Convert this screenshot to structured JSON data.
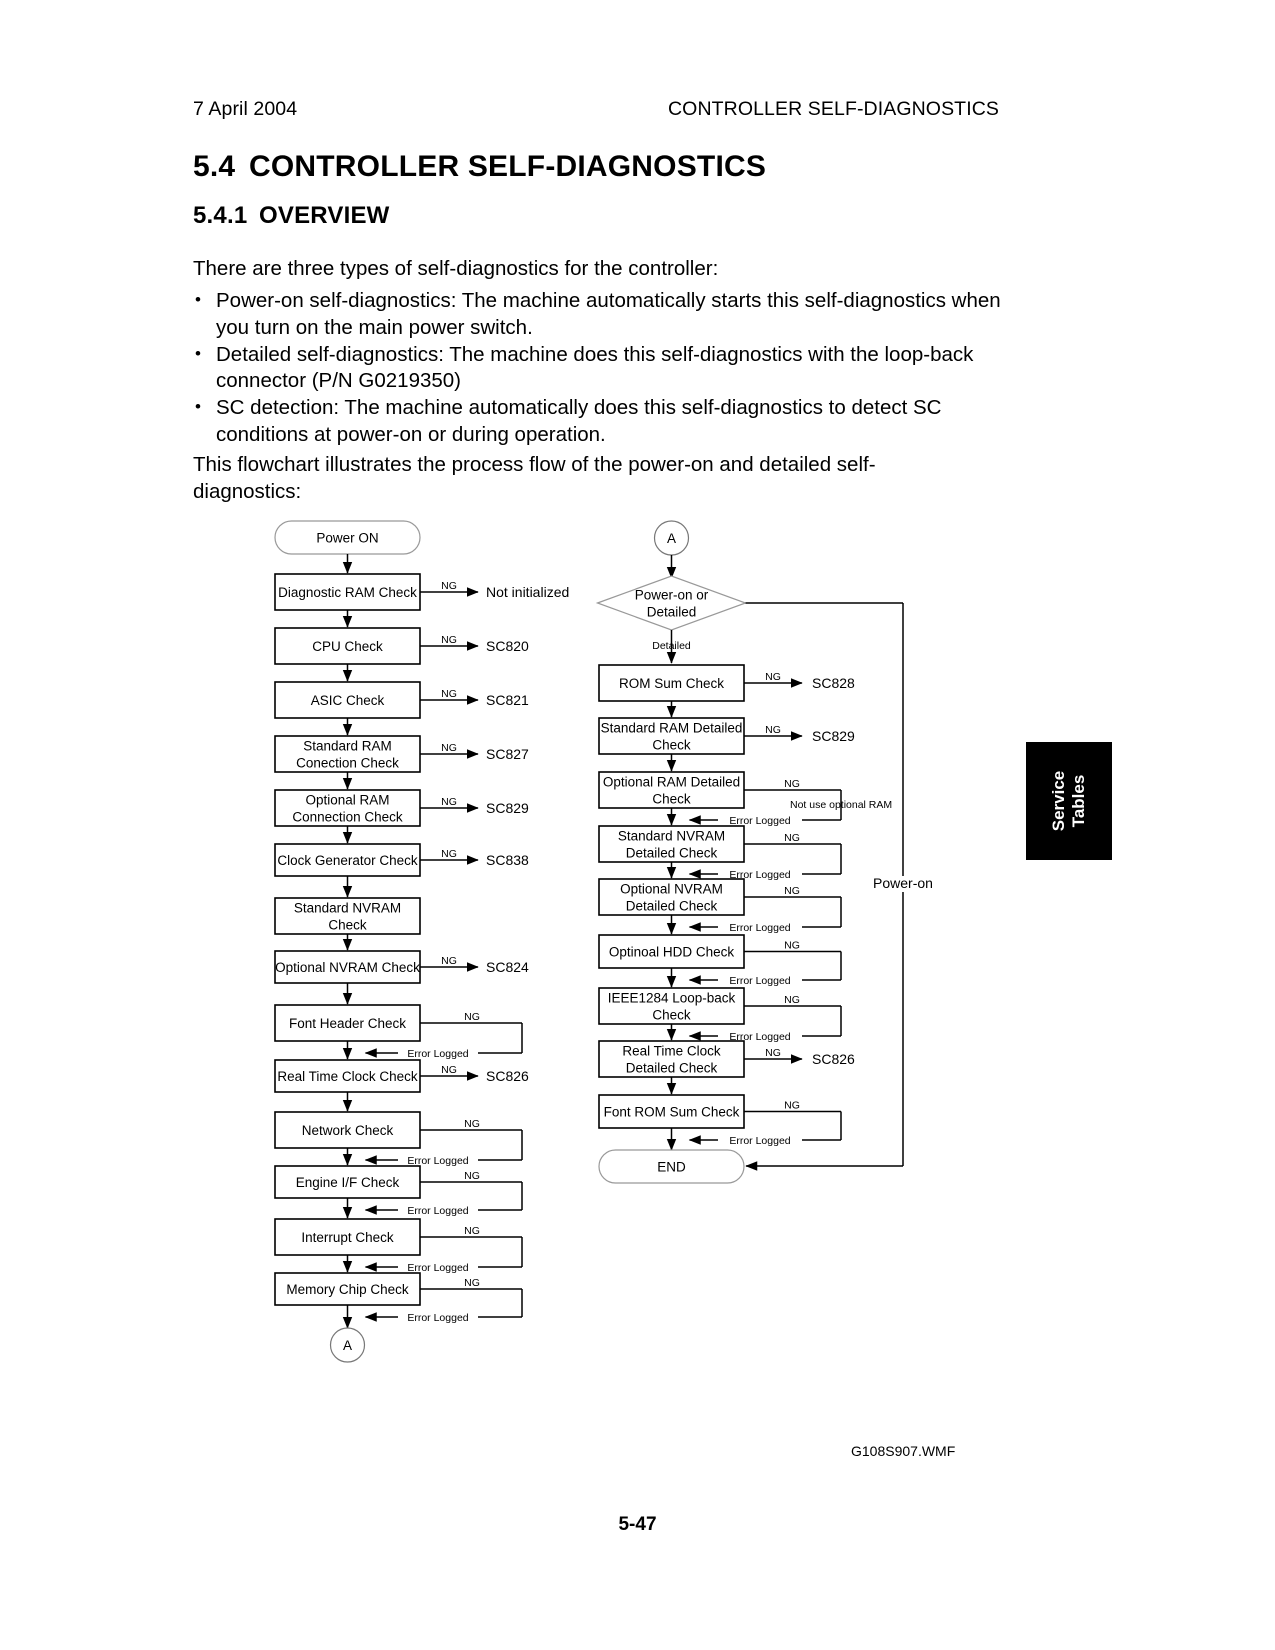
{
  "header": {
    "date": "7 April 2004",
    "title": "CONTROLLER SELF-DIAGNOSTICS"
  },
  "headings": {
    "section_number": "5.4",
    "section_title": "CONTROLLER SELF-DIAGNOSTICS",
    "subsection_number": "5.4.1",
    "subsection_title": "OVERVIEW"
  },
  "body": {
    "intro": "There are three types of self-diagnostics for the controller:",
    "bullets": [
      "Power-on self-diagnostics: The machine automatically starts this self-diagnostics when you turn on the main power switch.",
      "Detailed self-diagnostics: The machine does this self-diagnostics with the loop-back connector (P/N G0219350)",
      "SC detection: The machine automatically does this self-diagnostics to detect SC conditions at power-on or during operation."
    ],
    "flow_intro": "This flowchart illustrates the process flow of the power-on and detailed self-diagnostics:"
  },
  "side_tab": {
    "line1": "Service",
    "line2": "Tables"
  },
  "figure": {
    "id": "G108S907.WMF",
    "left_column": {
      "start": "Power ON",
      "connector": "A",
      "steps": [
        {
          "label": "Diagnostic RAM Check",
          "branch": "NG",
          "result": "Not initialized",
          "style": "arrow"
        },
        {
          "label": "CPU Check",
          "branch": "NG",
          "result": "SC820",
          "style": "arrow"
        },
        {
          "label": "ASIC Check",
          "branch": "NG",
          "result": "SC821",
          "style": "arrow"
        },
        {
          "label": "Standard RAM\nConection Check",
          "branch": "NG",
          "result": "SC827",
          "style": "arrow"
        },
        {
          "label": "Optional RAM\nConnection Check",
          "branch": "NG",
          "result": "SC829",
          "style": "arrow"
        },
        {
          "label": "Clock Generator Check",
          "branch": "NG",
          "result": "SC838",
          "style": "arrow"
        },
        {
          "label": "Standard NVRAM\nCheck",
          "branch": "",
          "result": "",
          "style": "none"
        },
        {
          "label": "Optional NVRAM Check",
          "branch": "NG",
          "result": "SC824",
          "style": "arrow"
        },
        {
          "label": "Font Header Check",
          "branch": "NG",
          "result": "Error Logged",
          "style": "loop"
        },
        {
          "label": "Real Time Clock Check",
          "branch": "NG",
          "result": "SC826",
          "style": "arrow"
        },
        {
          "label": "Network Check",
          "branch": "NG",
          "result": "Error Logged",
          "style": "loop"
        },
        {
          "label": "Engine I/F Check",
          "branch": "NG",
          "result": "Error Logged",
          "style": "loop"
        },
        {
          "label": "Interrupt Check",
          "branch": "NG",
          "result": "Error Logged",
          "style": "loop"
        },
        {
          "label": "Memory Chip Check",
          "branch": "NG",
          "result": "Error Logged",
          "style": "loop"
        }
      ]
    },
    "right_column": {
      "connector": "A",
      "decision": "Power-on or\nDetailed",
      "decision_branch_down": "Detailed",
      "decision_branch_right": "Power-on",
      "end": "END",
      "steps": [
        {
          "label": "ROM Sum Check",
          "branch": "NG",
          "result": "SC828",
          "style": "arrow"
        },
        {
          "label": "Standard RAM Detailed\nCheck",
          "branch": "NG",
          "result": "SC829",
          "style": "arrow"
        },
        {
          "label": "Optional RAM Detailed\nCheck",
          "branch": "NG",
          "result": "Error Logged",
          "note": "Not use optional RAM",
          "style": "loop"
        },
        {
          "label": "Standard NVRAM\nDetailed Check",
          "branch": "NG",
          "result": "Error Logged",
          "style": "loop"
        },
        {
          "label": "Optional NVRAM\nDetailed Check",
          "branch": "NG",
          "result": "Error Logged",
          "style": "loop"
        },
        {
          "label": "Optinoal HDD Check",
          "branch": "NG",
          "result": "Error Logged",
          "style": "loop"
        },
        {
          "label": "IEEE1284 Loop-back\nCheck",
          "branch": "NG",
          "result": "Error Logged",
          "style": "loop"
        },
        {
          "label": "Real Time Clock\nDetailed Check",
          "branch": "NG",
          "result": "SC826",
          "style": "arrow"
        },
        {
          "label": "Font ROM Sum Check",
          "branch": "NG",
          "result": "Error Logged",
          "style": "loop"
        }
      ]
    }
  },
  "footer": {
    "page_number": "5-47"
  }
}
